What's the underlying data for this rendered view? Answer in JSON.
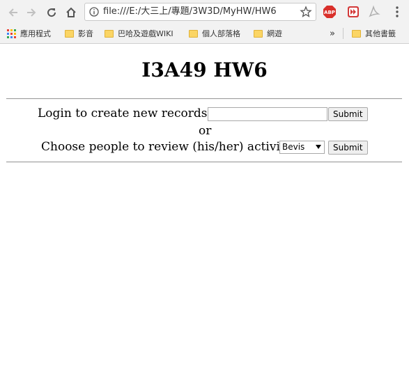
{
  "browser": {
    "url": "file:///E:/大三上/專題/3W3D/MyHW/HW6",
    "bookmarks": [
      {
        "label": "應用程式",
        "icon": "apps-grid-icon"
      },
      {
        "label": "影音",
        "icon": "folder-icon"
      },
      {
        "label": "巴哈及遊戲WIKI",
        "icon": "folder-icon"
      },
      {
        "label": "個人部落格",
        "icon": "folder-icon"
      },
      {
        "label": "網遊",
        "icon": "folder-icon"
      }
    ],
    "overflow_label": "»",
    "other_bookmarks": "其他書籤",
    "extensions": {
      "abp_label": "ABP"
    }
  },
  "page": {
    "title": "I3A49 HW6",
    "login_label": "Login to create new records",
    "login_input_value": "",
    "submit_label": "Submit",
    "or_label": "or",
    "review_label": "Choose people to review (his/her) activity",
    "select_value": "Bevis",
    "submit2_label": "Submit"
  },
  "colors": {
    "chrome_bg": "#f2f2f2",
    "abp_red": "#d9302b",
    "ext_red": "#d33a3a",
    "folder_yellow": "#fbd565"
  }
}
